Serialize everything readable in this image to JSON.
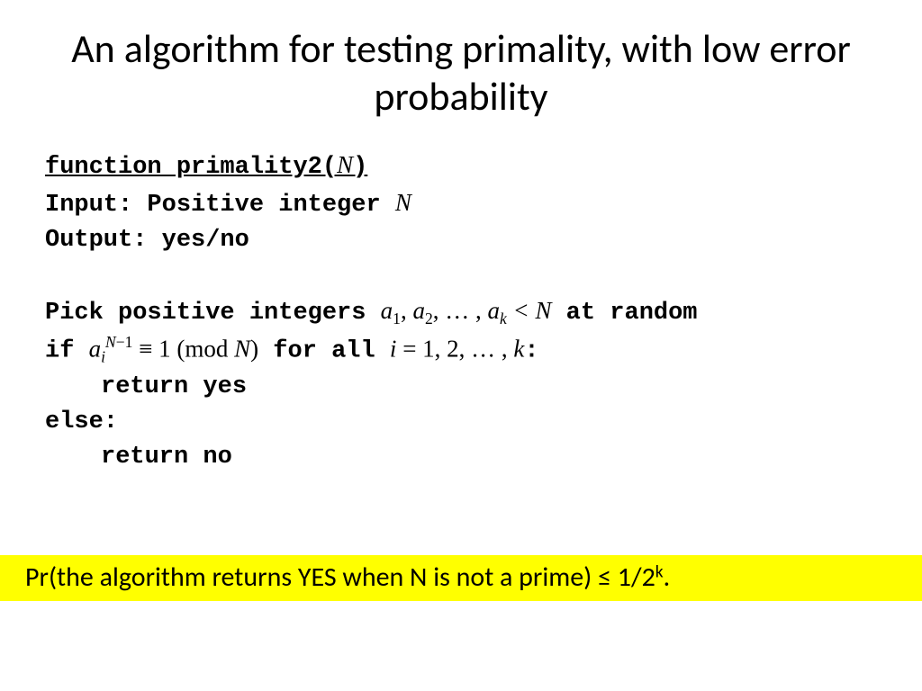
{
  "title": "An algorithm for testing primality, with low error probability",
  "code": {
    "func_prefix": "function primality2(",
    "func_var": "N",
    "func_close": ")",
    "input_label": "Input:  Positive integer ",
    "input_var": "N",
    "output_line": "Output:  yes/no",
    "pick_prefix": "Pick positive integers ",
    "pick_a1": "a",
    "pick_a1_sub": "1",
    "pick_sep1": ", ",
    "pick_a2": "a",
    "pick_a2_sub": "2",
    "pick_sep2": ", … , ",
    "pick_ak": "a",
    "pick_ak_sub": "k",
    "pick_lt": " < ",
    "pick_N": "N",
    "pick_suffix": " at random",
    "if_label": "if  ",
    "if_base": "a",
    "if_sub": "i",
    "if_sup_N": "N",
    "if_sup_minus1": "−1",
    "if_equiv": " ≡ ",
    "if_one": "1 ",
    "if_mod_open": "(mod ",
    "if_mod_N": "N",
    "if_mod_close": ")",
    "if_forall": " for all ",
    "if_i": "i ",
    "if_eq": "= ",
    "if_range": "1, 2, … , ",
    "if_k": "k",
    "if_colon": ":",
    "ret_yes": "return yes",
    "else_line": "else:",
    "ret_no": "return no"
  },
  "footer": {
    "prefix": "Pr(the algorithm returns YES when N is not a prime) ≤ 1/2",
    "exp": "k",
    "suffix": "."
  }
}
